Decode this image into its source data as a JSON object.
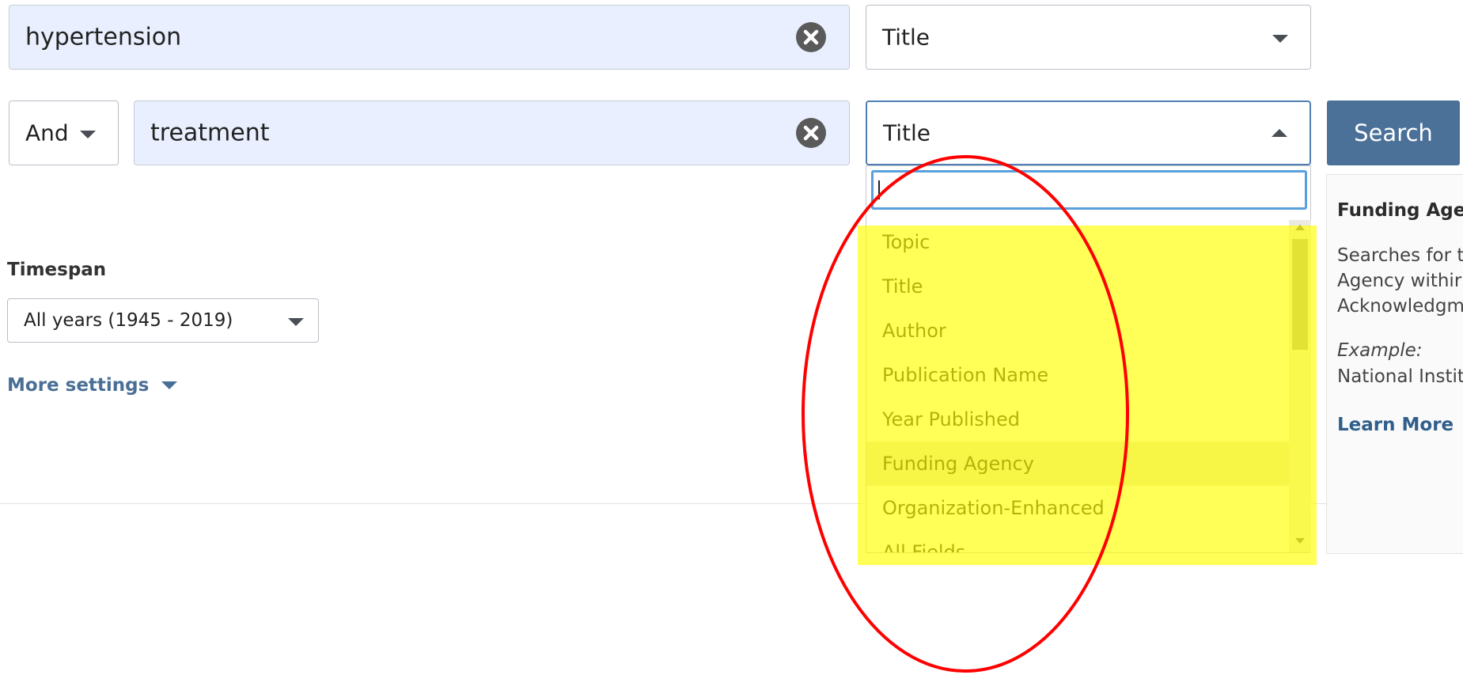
{
  "row1": {
    "query": "hypertension",
    "field": "Title"
  },
  "row2": {
    "operator": "And",
    "query": "treatment",
    "field": "Title"
  },
  "search_label": "Search",
  "timespan": {
    "label": "Timespan",
    "value": "All years (1945 - 2019)"
  },
  "more_settings": "More settings",
  "dropdown": {
    "search_value": "",
    "options": [
      "Topic",
      "Title",
      "Author",
      "Publication Name",
      "Year Published",
      "Funding Agency",
      "Organization-Enhanced",
      "All Fields"
    ],
    "active": "Funding Agency"
  },
  "info": {
    "title": "Funding Agen",
    "line1": "Searches for t",
    "line2": "Agency withir",
    "line3": "Acknowledgm",
    "example_label": "Example:",
    "example_value": "National Instit",
    "learn_more": "Learn More"
  },
  "colors": {
    "highlight": "#ffff00",
    "annotation": "#ff0000",
    "button": "#4c7199"
  }
}
